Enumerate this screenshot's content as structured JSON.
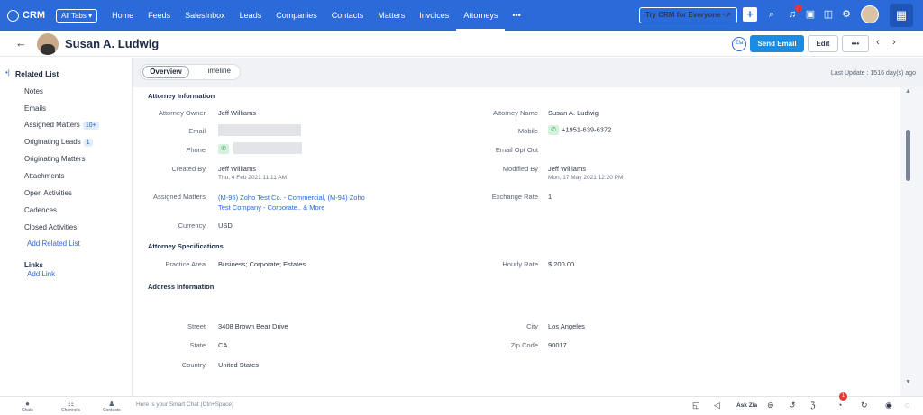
{
  "topnav": {
    "brand": "CRM",
    "all_tabs": "All Tabs ▾",
    "items": [
      "Home",
      "Feeds",
      "SalesInbox",
      "Leads",
      "Companies",
      "Contacts",
      "Matters",
      "Invoices",
      "Attorneys",
      "•••"
    ],
    "active": "Attorneys",
    "try_crm": "Try CRM for Everyone ·↗",
    "notification_count": "2"
  },
  "record": {
    "name": "Susan A. Ludwig",
    "send_email": "Send Email",
    "edit": "Edit",
    "more": "•••"
  },
  "sidebar": {
    "heading": "Related List",
    "items": [
      {
        "label": "Notes"
      },
      {
        "label": "Emails"
      },
      {
        "label": "Assigned Matters",
        "badge": "10+"
      },
      {
        "label": "Originating Leads",
        "badge": "1"
      },
      {
        "label": "Originating Matters"
      },
      {
        "label": "Attachments"
      },
      {
        "label": "Open Activities"
      },
      {
        "label": "Cadences"
      },
      {
        "label": "Closed Activities"
      }
    ],
    "add_related": "Add Related List",
    "links_heading": "Links",
    "add_link": "Add Link"
  },
  "tabs": {
    "overview": "Overview",
    "timeline": "Timeline",
    "last_update": "Last Update : 1516 day(s) ago"
  },
  "sections": {
    "attorney_info": "Attorney Information",
    "attorney_specs": "Attorney Specifications",
    "address_info": "Address Information"
  },
  "fields": {
    "attorney_owner_label": "Attorney Owner",
    "attorney_owner": "Jeff Williams",
    "attorney_name_label": "Attorney Name",
    "attorney_name": "Susan A. Ludwig",
    "email_label": "Email",
    "mobile_label": "Mobile",
    "mobile": "+1951-639-6372",
    "phone_label": "Phone",
    "email_opt_out_label": "Email Opt Out",
    "created_by_label": "Created By",
    "created_by": "Jeff Williams",
    "created_on": "Thu, 4 Feb 2021 11:11 AM",
    "modified_by_label": "Modified By",
    "modified_by": "Jeff Williams",
    "modified_on": "Mon, 17 May 2021 12:20 PM",
    "assigned_matters_label": "Assigned Matters",
    "assigned_matters_line1": "(M-95) Zoho Test Co. - Commercial, (M-94) Zoho",
    "assigned_matters_line2": "Test Company - Corporate.. & More",
    "exchange_rate_label": "Exchange Rate",
    "exchange_rate": "1",
    "currency_label": "Currency",
    "currency": "USD",
    "practice_area_label": "Practice Area",
    "practice_area": "Business; Corporate; Estates",
    "hourly_rate_label": "Hourly Rate",
    "hourly_rate": "$ 200.00",
    "street_label": "Street",
    "street": "3408 Brown Bear Drive",
    "city_label": "City",
    "city": "Los Angeles",
    "state_label": "State",
    "state": "CA",
    "zip_label": "Zip Code",
    "zip": "90017",
    "country_label": "Country",
    "country": "United States"
  },
  "bottombar": {
    "chats": "Chats",
    "channels": "Channels",
    "contacts": "Contacts",
    "smart_chat": "Here is your Smart Chat (Ctrl+Space)",
    "ask_zia": "Ask Zia",
    "badge": "1"
  },
  "colors": {
    "brand_blue": "#2a6ad9",
    "primary_button": "#1a8ce3",
    "badge_red": "#e53935"
  }
}
